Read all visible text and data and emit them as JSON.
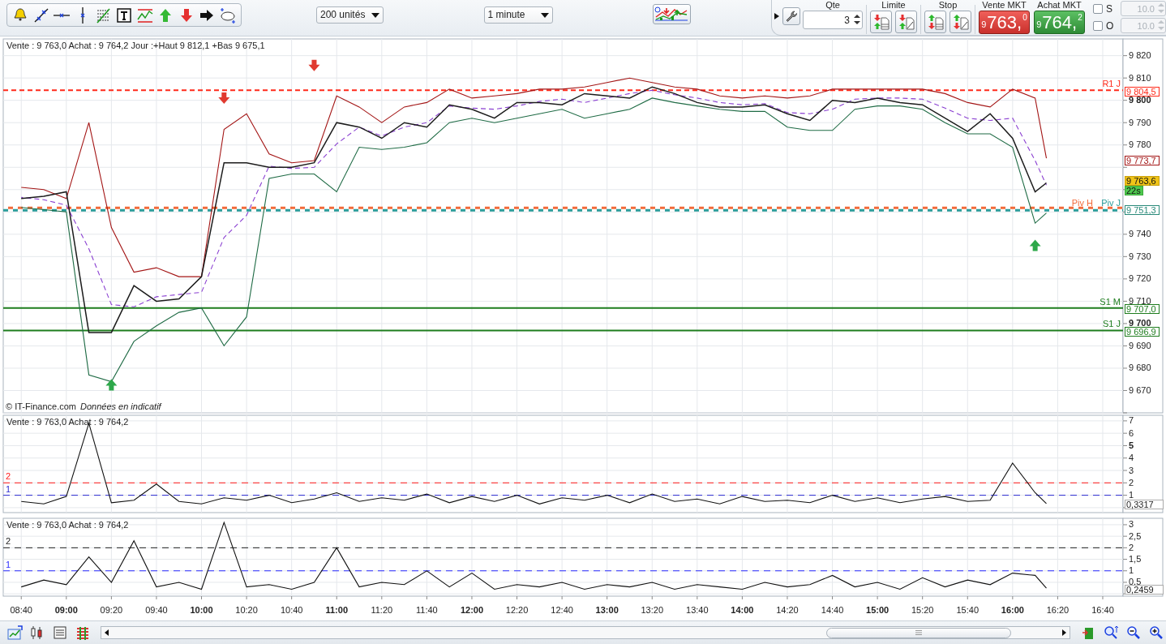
{
  "toolbar": {
    "drawing_tools": [
      {
        "kind": "alert"
      },
      {
        "kind": "trend-line"
      },
      {
        "kind": "horizontal-line"
      },
      {
        "kind": "vertical-line"
      },
      {
        "kind": "fibonacci"
      },
      {
        "kind": "text"
      },
      {
        "kind": "channel"
      },
      {
        "kind": "arrow-up"
      },
      {
        "kind": "arrow-down"
      },
      {
        "kind": "arrow-right"
      },
      {
        "kind": "ellipse"
      }
    ],
    "units_select": {
      "value": "200 unités"
    },
    "interval_select": {
      "value": "1 minute"
    }
  },
  "order_panel": {
    "quantity_label": "Qte",
    "quantity": "3",
    "limit_label": "Limite",
    "stop_label": "Stop",
    "sell": {
      "label": "Vente MKT",
      "lead": "9",
      "main": "763,",
      "tail": "0"
    },
    "buy": {
      "label": "Achat MKT",
      "lead": "9",
      "main": "764,",
      "tail": "2"
    },
    "options": [
      {
        "label": "S",
        "checked": false,
        "value": "10.0",
        "disabled": true
      },
      {
        "label": "O",
        "checked": false,
        "value": "10.0",
        "disabled": true
      }
    ]
  },
  "main_chart": {
    "header": "Vente : 9 763,0 Achat : 9 764,2 Jour :+Haut 9 812,1 +Bas 9 675,1",
    "credit": "© IT-Finance.com",
    "credit_note": "Données en indicatif",
    "chart_data": {
      "type": "line",
      "grid": true,
      "x": [
        520,
        530,
        540,
        550,
        560,
        570,
        580,
        590,
        600,
        610,
        620,
        630,
        640,
        650,
        660,
        670,
        680,
        690,
        700,
        710,
        720,
        730,
        740,
        750,
        760,
        770,
        780,
        790,
        800,
        810,
        820,
        830,
        840,
        850,
        860,
        870,
        880,
        890,
        900,
        910,
        920,
        930,
        940,
        950,
        960,
        970,
        975
      ],
      "series": [
        {
          "color": "#a31515",
          "values": [
            9761,
            9760,
            9756,
            9790,
            9743,
            9723,
            9725,
            9721,
            9721,
            9787,
            9794,
            9776,
            9772,
            9773,
            9802,
            9797,
            9790,
            9797,
            9799,
            9805,
            9801,
            9802,
            9803,
            9805,
            9805,
            9806,
            9808,
            9810,
            9808,
            9806,
            9805,
            9802,
            9801,
            9802,
            9801,
            9802,
            9805,
            9805,
            9805,
            9805,
            9805,
            9803,
            9799,
            9797,
            9805,
            9801,
            9774
          ]
        },
        {
          "color": "#8a3fd1",
          "line_style": "dashed",
          "values": [
            9756.5,
            9755.5,
            9753,
            9733.5,
            9708.5,
            9707.5,
            9712,
            9713,
            9714,
            9738.5,
            9748.5,
            9770.5,
            9769.5,
            9770,
            9780.5,
            9788,
            9784,
            9788,
            9790,
            9797.5,
            9796.5,
            9796,
            9797.5,
            9799.5,
            9800.5,
            9799,
            9801,
            9803,
            9804.5,
            9802.5,
            9801,
            9799,
            9798,
            9798.5,
            9794.5,
            9794,
            9796,
            9800.5,
            9801,
            9801,
            9800.5,
            9796.5,
            9792,
            9791,
            9792,
            9773,
            9762
          ]
        },
        {
          "color": "#1f6b45",
          "values": [
            9752,
            9751,
            9750,
            9677,
            9674,
            9692,
            9699,
            9705,
            9707,
            9690,
            9703,
            9765,
            9767,
            9767,
            9759,
            9779,
            9778,
            9779,
            9781,
            9790,
            9792,
            9790,
            9792,
            9794,
            9796,
            9792,
            9794,
            9796,
            9801,
            9799,
            9797.5,
            9796,
            9795,
            9795,
            9788,
            9786.5,
            9786.5,
            9796,
            9797.5,
            9797.5,
            9796,
            9790,
            9785,
            9785,
            9779,
            9745,
            9749.5
          ]
        },
        {
          "color": "#1c1c1c",
          "values": [
            9756,
            9757,
            9759,
            9696,
            9696,
            9717,
            9710,
            9711,
            9721,
            9772,
            9772,
            9770,
            9770,
            9772,
            9790,
            9788,
            9783,
            9790,
            9788,
            9798,
            9796,
            9792,
            9799,
            9799,
            9798,
            9803,
            9802,
            9801,
            9806,
            9803,
            9799,
            9797,
            9797,
            9798,
            9794,
            9791,
            9800,
            9799,
            9801,
            9799,
            9798,
            9792,
            9786,
            9794,
            9783,
            9759,
            9763
          ]
        },
        {
          "type": "scatter",
          "color": "#e03a30",
          "values": [
            null,
            null,
            null,
            null,
            null,
            null,
            null,
            null,
            null,
            9801,
            null,
            null,
            null,
            9815.6,
            null,
            null,
            null,
            null,
            null,
            null,
            null,
            null,
            null,
            null,
            null,
            null,
            null,
            null,
            null,
            null,
            null,
            null,
            null,
            null,
            null,
            null,
            null,
            null,
            null,
            null,
            null,
            null,
            null,
            null,
            null,
            null,
            null
          ]
        },
        {
          "type": "scatter",
          "color": "#2ea84a",
          "values": [
            null,
            null,
            null,
            null,
            9672.5,
            null,
            null,
            null,
            null,
            null,
            null,
            null,
            null,
            null,
            null,
            null,
            null,
            null,
            null,
            null,
            null,
            null,
            null,
            null,
            null,
            null,
            null,
            null,
            null,
            null,
            null,
            null,
            null,
            null,
            null,
            null,
            null,
            null,
            null,
            null,
            null,
            null,
            null,
            null,
            null,
            9735,
            null
          ]
        }
      ],
      "xlim": [
        512,
        1009
      ],
      "ylim": [
        9660,
        9827.5
      ],
      "yticks": [
        {
          "value": 9670,
          "label": "9 670"
        },
        {
          "value": 9680,
          "label": "9 680"
        },
        {
          "value": 9690,
          "label": "9 690"
        },
        {
          "value": 9700,
          "label": "9 700"
        },
        {
          "value": 9710,
          "label": "9 710"
        },
        {
          "value": 9720,
          "label": "9 720"
        },
        {
          "value": 9730,
          "label": "9 730"
        },
        {
          "value": 9740,
          "label": "9 740"
        },
        {
          "value": 9780,
          "label": "9 780"
        },
        {
          "value": 9790,
          "label": "9 790"
        },
        {
          "value": 9800,
          "label": "9 800"
        },
        {
          "value": 9810,
          "label": "9 810"
        },
        {
          "value": 9820,
          "label": "9 820"
        }
      ],
      "ref_lines": [
        {
          "axis": "y",
          "value": 9804.5,
          "label": "R1 J",
          "color": "#ff2a1a"
        },
        {
          "axis": "y",
          "value": 9751.3,
          "label": "Piv J",
          "color": "#2a9d9a"
        },
        {
          "axis": "y",
          "value": 9751.3,
          "label": "Piv H",
          "color": "#f26b3a"
        },
        {
          "axis": "y",
          "value": 9707.0,
          "label": "S1 M",
          "color": "#1e7d1e"
        },
        {
          "axis": "y",
          "value": 9696.9,
          "label": "S1 J",
          "color": "#1e7d1e"
        }
      ]
    },
    "axis_tags": [
      {
        "kind": "level",
        "text": "9 804,5",
        "color": "#ff2a1a"
      },
      {
        "kind": "level",
        "text": "9 773,7",
        "color": "#a31515"
      },
      {
        "kind": "current",
        "text": "9 763,6"
      },
      {
        "kind": "timer",
        "text": "22s"
      },
      {
        "kind": "level",
        "text": "9 751,3",
        "color": "#2a8a7a"
      },
      {
        "kind": "level",
        "text": "9 707,0",
        "color": "#1e7d1e"
      },
      {
        "kind": "level",
        "text": "9 696,9",
        "color": "#1e7d1e"
      }
    ]
  },
  "indicator_panel": {
    "header": "Vente : 9 763,0 Achat : 9 764,2",
    "chart_data": {
      "type": "line",
      "grid": true,
      "x": [
        520,
        530,
        540,
        550,
        560,
        570,
        580,
        590,
        600,
        610,
        620,
        630,
        640,
        650,
        660,
        670,
        680,
        690,
        700,
        710,
        720,
        730,
        740,
        750,
        760,
        770,
        780,
        790,
        800,
        810,
        820,
        830,
        840,
        850,
        860,
        870,
        880,
        890,
        900,
        910,
        920,
        930,
        940,
        950,
        960,
        970,
        975
      ],
      "series": [
        {
          "color": "#111111",
          "values": [
            0.5,
            0.3,
            0.9,
            6.8,
            0.4,
            0.6,
            1.9,
            0.5,
            0.3,
            0.8,
            0.6,
            1.0,
            0.4,
            0.7,
            1.2,
            0.5,
            0.8,
            0.6,
            1.1,
            0.4,
            0.9,
            0.5,
            1.0,
            0.3,
            0.8,
            0.6,
            1.0,
            0.4,
            1.1,
            0.5,
            0.7,
            0.3,
            0.9,
            0.5,
            0.6,
            0.4,
            1.0,
            0.5,
            0.8,
            0.4,
            0.7,
            0.9,
            0.5,
            0.6,
            3.6,
            1.2,
            0.33
          ]
        }
      ],
      "xlim": [
        512,
        1009
      ],
      "ylim": [
        -0.4,
        7.45
      ],
      "yticks": [
        {
          "value": 1,
          "label": "1"
        },
        {
          "value": 2,
          "label": "2"
        },
        {
          "value": 3,
          "label": "3"
        },
        {
          "value": 4,
          "label": "4"
        },
        {
          "value": 5,
          "label": "5"
        },
        {
          "value": 6,
          "label": "6"
        },
        {
          "value": 7,
          "label": "7"
        }
      ],
      "ref_lines": [
        {
          "axis": "y",
          "value": 2,
          "label": "2",
          "color": "#ff1a1a"
        },
        {
          "axis": "y",
          "value": 1,
          "label": "1",
          "color": "#2a2ad0"
        }
      ]
    },
    "axis_tags": [
      {
        "kind": "plain",
        "text": "0,3317"
      }
    ]
  },
  "volume_panel": {
    "header": "Vente : 9 763,0 Achat : 9 764,2",
    "chart_data": {
      "type": "line",
      "grid": true,
      "x": [
        520,
        530,
        540,
        550,
        560,
        570,
        580,
        590,
        600,
        610,
        620,
        630,
        640,
        650,
        660,
        670,
        680,
        690,
        700,
        710,
        720,
        730,
        740,
        750,
        760,
        770,
        780,
        790,
        800,
        810,
        820,
        830,
        840,
        850,
        860,
        870,
        880,
        890,
        900,
        910,
        920,
        930,
        940,
        950,
        960,
        970,
        975
      ],
      "series": [
        {
          "color": "#111111",
          "values": [
            0.3,
            0.6,
            0.4,
            1.6,
            0.5,
            2.3,
            0.3,
            0.5,
            0.2,
            3.1,
            0.3,
            0.4,
            0.2,
            0.5,
            2.0,
            0.3,
            0.5,
            0.4,
            1.0,
            0.3,
            0.9,
            0.2,
            0.4,
            0.3,
            0.5,
            0.2,
            0.4,
            0.3,
            0.5,
            0.2,
            0.4,
            0.3,
            0.2,
            0.5,
            0.3,
            0.4,
            0.8,
            0.3,
            0.5,
            0.2,
            0.7,
            0.3,
            0.6,
            0.4,
            0.9,
            0.8,
            0.25
          ]
        }
      ],
      "xlim": [
        512,
        1009
      ],
      "ylim": [
        -0.1,
        3.28
      ],
      "xticks": [
        {
          "value": 520,
          "label": "08:40"
        },
        {
          "value": 540,
          "label": "09:00"
        },
        {
          "value": 560,
          "label": "09:20"
        },
        {
          "value": 580,
          "label": "09:40"
        },
        {
          "value": 600,
          "label": "10:00"
        },
        {
          "value": 620,
          "label": "10:20"
        },
        {
          "value": 640,
          "label": "10:40"
        },
        {
          "value": 660,
          "label": "11:00"
        },
        {
          "value": 680,
          "label": "11:20"
        },
        {
          "value": 700,
          "label": "11:40"
        },
        {
          "value": 720,
          "label": "12:00"
        },
        {
          "value": 740,
          "label": "12:20"
        },
        {
          "value": 760,
          "label": "12:40"
        },
        {
          "value": 780,
          "label": "13:00"
        },
        {
          "value": 800,
          "label": "13:20"
        },
        {
          "value": 820,
          "label": "13:40"
        },
        {
          "value": 840,
          "label": "14:00"
        },
        {
          "value": 860,
          "label": "14:20"
        },
        {
          "value": 880,
          "label": "14:40"
        },
        {
          "value": 900,
          "label": "15:00"
        },
        {
          "value": 920,
          "label": "15:20"
        },
        {
          "value": 940,
          "label": "15:40"
        },
        {
          "value": 960,
          "label": "16:00"
        },
        {
          "value": 980,
          "label": "16:20"
        },
        {
          "value": 1000,
          "label": "16:40"
        }
      ],
      "yticks": [
        {
          "value": 0.5,
          "label": "0,5"
        },
        {
          "value": 1,
          "label": "1"
        },
        {
          "value": 1.5,
          "label": "1,5"
        },
        {
          "value": 2,
          "label": "2"
        },
        {
          "value": 2.5,
          "label": "2,5"
        },
        {
          "value": 3,
          "label": "3"
        }
      ],
      "ref_lines": [
        {
          "axis": "y",
          "value": 2,
          "label": "2",
          "color": "#222222"
        },
        {
          "axis": "y",
          "value": 1,
          "label": "1",
          "color": "#2a2aff"
        }
      ]
    },
    "axis_tags": [
      {
        "kind": "plain",
        "text": "0,2459"
      }
    ]
  }
}
